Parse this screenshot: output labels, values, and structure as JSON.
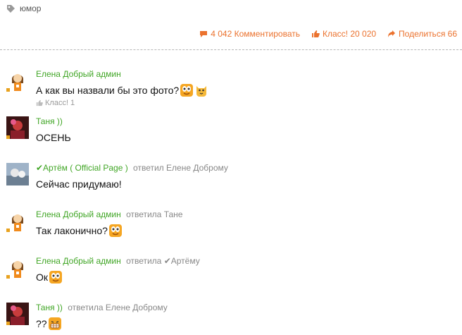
{
  "tag": {
    "label": "юмор",
    "icon": "tag-icon"
  },
  "actions": {
    "comment_label": "4 042 Комментировать",
    "klass_label": "Класс! 20 020",
    "share_label": "Поделиться 66",
    "accent_color": "#eb722e"
  },
  "comments": [
    {
      "author": "Елена Добрый админ",
      "reply_prefix": "",
      "reply_target": "",
      "text": "А как вы назвали бы это фото?",
      "emojis": [
        "big-eyes-smiley-icon",
        "cat-smiley-icon"
      ],
      "klass": "Класс! 1",
      "avatar": "girl-avatar-icon"
    },
    {
      "author": "Таня ))",
      "reply_prefix": "",
      "reply_target": "",
      "text": "ОСЕНЬ",
      "emojis": [],
      "klass": "",
      "avatar": "photo-avatar-red"
    },
    {
      "author": "✔Артём ( Official Page )",
      "reply_prefix": "ответил",
      "reply_target": "Елене Доброму",
      "text": "Сейчас придумаю!",
      "emojis": [],
      "klass": "",
      "avatar": "photo-avatar-blue"
    },
    {
      "author": "Елена Добрый админ",
      "reply_prefix": "ответила",
      "reply_target": "Тане",
      "text": "Так лаконично?",
      "emojis": [
        "big-eyes-smiley-icon"
      ],
      "klass": "",
      "avatar": "girl-avatar-icon"
    },
    {
      "author": "Елена Добрый админ",
      "reply_prefix": "ответила",
      "reply_target": "✔Артёму",
      "text": "Ок",
      "emojis": [
        "big-eyes-smiley-icon"
      ],
      "klass": "",
      "avatar": "girl-avatar-icon"
    },
    {
      "author": "Таня ))",
      "reply_prefix": "ответила",
      "reply_target": "Елене Доброму",
      "text": "??",
      "emojis": [
        "grin-smiley-icon"
      ],
      "klass": "",
      "avatar": "photo-avatar-red"
    }
  ]
}
